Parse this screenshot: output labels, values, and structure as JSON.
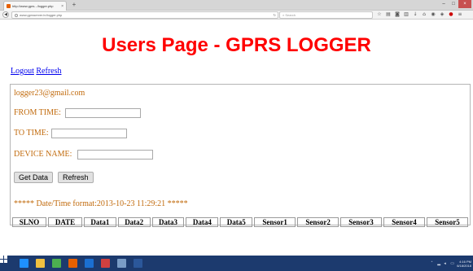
{
  "browser": {
    "tab_title": "http://www.gprs.../logger.php",
    "tab_close": "×",
    "new_tab": "+",
    "url": "www.gprsserver.in/logger.php",
    "reload": "↻",
    "search_placeholder": "Search",
    "window_controls": {
      "minimize": "–",
      "maximize": "□",
      "close": "×"
    },
    "toolbar_icons": [
      "star-icon",
      "reader-icon",
      "pocket-icon",
      "library-icon",
      "download-icon",
      "home-icon",
      "shield-icon",
      "addon-icon",
      "adblock-icon",
      "menu-icon"
    ]
  },
  "page": {
    "title": "Users Page - GPRS LOGGER",
    "links": {
      "logout": "Logout",
      "refresh": "Refresh"
    },
    "email": "logger23@gmail.com",
    "from_time_label": "FROM TIME:",
    "from_time_value": "",
    "to_time_label": "TO TIME:",
    "to_time_value": "",
    "device_name_label": "DEVICE NAME:",
    "device_name_value": "",
    "get_data_button": "Get Data",
    "refresh_button": "Refresh",
    "format_note": "***** Date/Time format:2013-10-23 11:29:21 *****"
  },
  "table": {
    "headers": [
      "SLNO",
      "DATE",
      "Data1",
      "Data2",
      "Data3",
      "Data4",
      "Data5",
      "Sensor1",
      "Sensor2",
      "Sensor3",
      "Sensor4",
      "Sensor5"
    ]
  },
  "taskbar": {
    "apps": [
      {
        "name": "internet-explorer-icon",
        "color": "#1e90ff"
      },
      {
        "name": "file-explorer-icon",
        "color": "#f0c040"
      },
      {
        "name": "chrome-icon",
        "color": "#4caf50"
      },
      {
        "name": "firefox-icon",
        "color": "#e66000"
      },
      {
        "name": "media-player-icon",
        "color": "#1b6fd1"
      },
      {
        "name": "paint-icon",
        "color": "#d04040"
      },
      {
        "name": "mail-icon",
        "color": "#7a9cc6"
      },
      {
        "name": "word-icon",
        "color": "#2b579a"
      }
    ],
    "time": "4:16 PM",
    "date": "6/18/2018"
  }
}
